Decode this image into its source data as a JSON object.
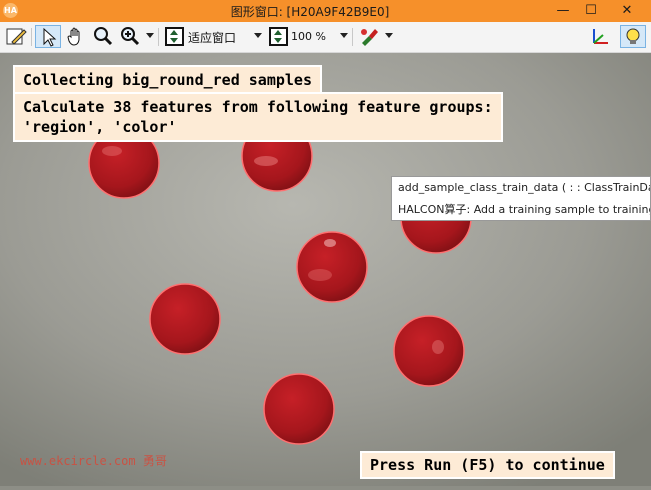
{
  "window": {
    "app_icon_text": "HA",
    "title": "图形窗口: [H20A9F42B9E0]",
    "controls": {
      "minimize": "—",
      "maximize": "☐",
      "close": "✕"
    }
  },
  "toolbar": {
    "fit_label": "适应窗口",
    "zoom_label": "100 %"
  },
  "messages": {
    "line1": "Collecting big_round_red samples",
    "line2": "Calculate 38 features from following feature groups:\n'region', 'color'",
    "continue": "Press Run (F5) to continue"
  },
  "tooltip": {
    "line1": "add_sample_class_train_data ( : : ClassTrainData",
    "line2": "HALCON算子: Add a training sample to training data"
  },
  "watermark": "www.ekcircle.com 勇哥",
  "colors": {
    "title_bar": "#f6902a",
    "message_bg": "#fdebd6",
    "sample_red": "#b5171c",
    "outline": "#ff7070"
  }
}
